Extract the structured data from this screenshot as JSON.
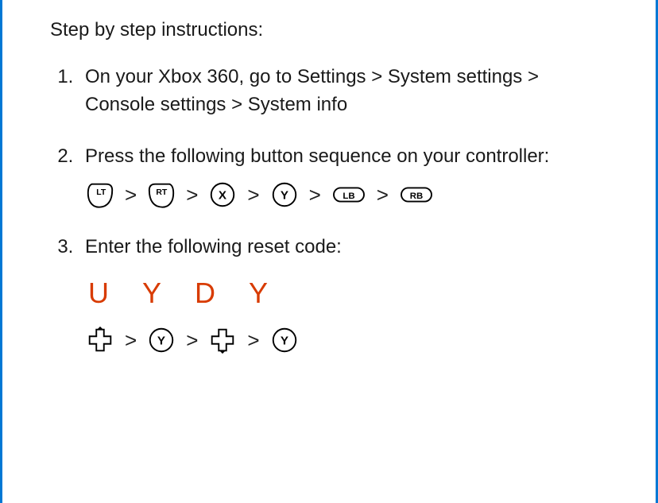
{
  "heading": "Step by step instructions:",
  "steps": {
    "s1": "On your Xbox 360, go to Settings > System settings > Console settings > System info",
    "s2": "Press the following button sequence on your controller:",
    "s3": "Enter the following reset code:"
  },
  "buttons": {
    "lt": "LT",
    "rt": "RT",
    "x": "X",
    "y": "Y",
    "lb": "LB",
    "rb": "RB"
  },
  "reset_code": {
    "c1": "U",
    "c2": "Y",
    "c3": "D",
    "c4": "Y"
  },
  "chevron": ">"
}
